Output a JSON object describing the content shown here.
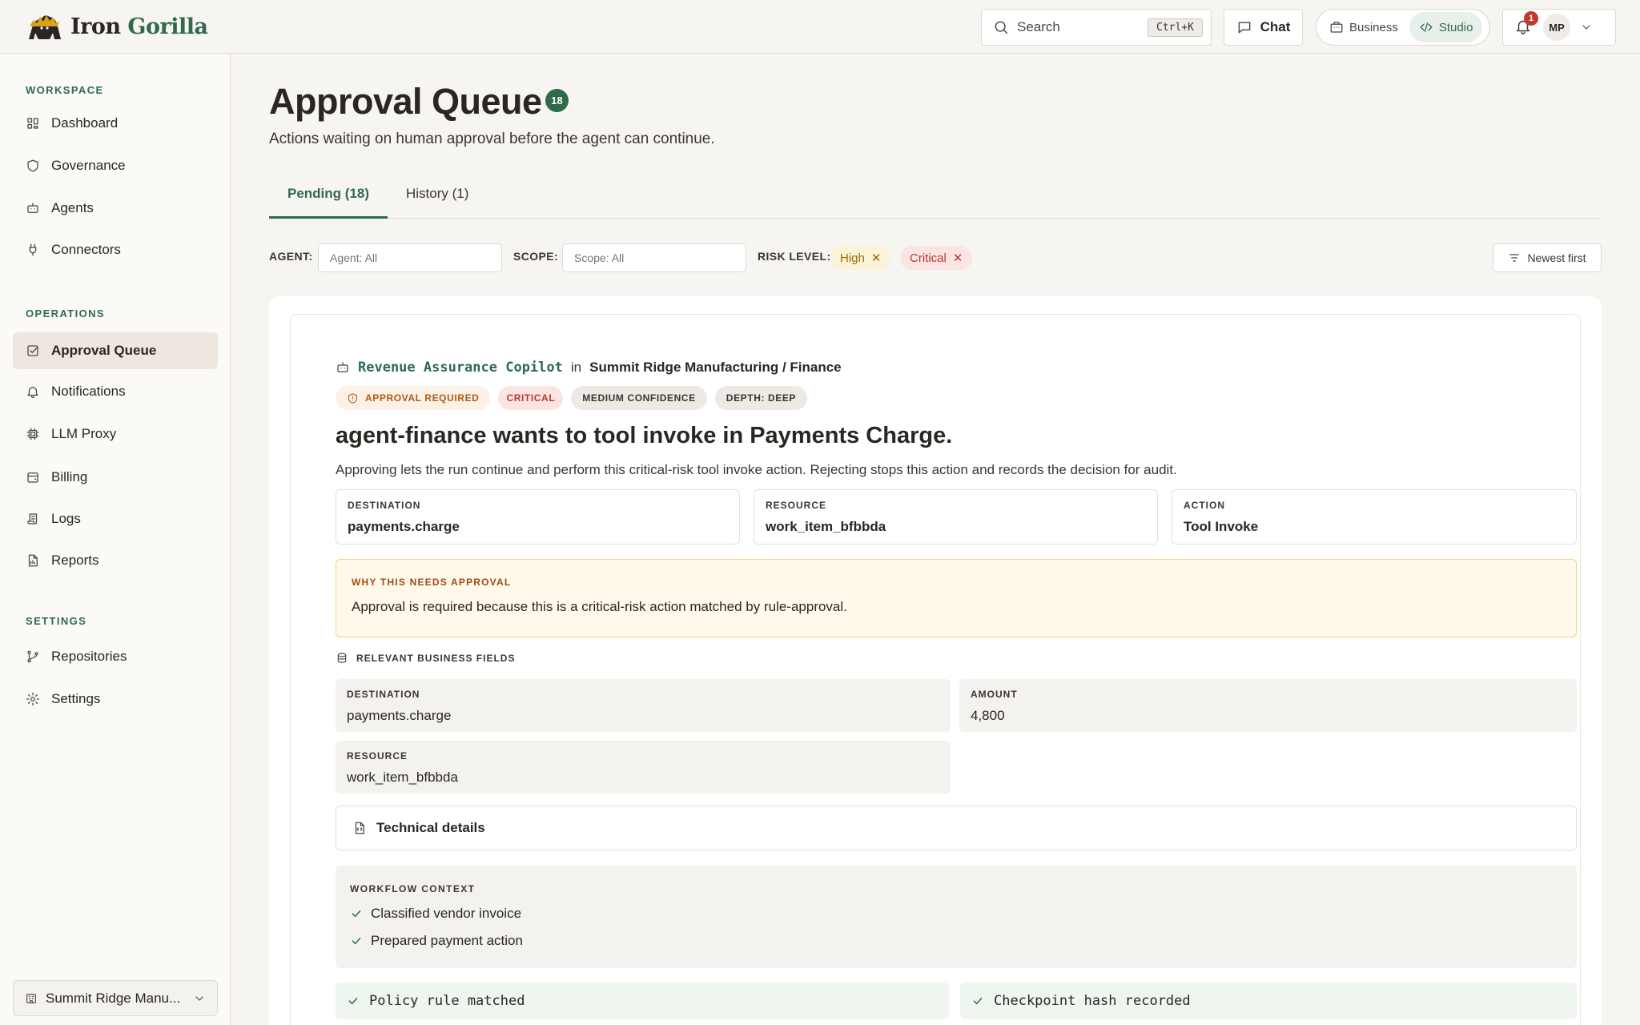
{
  "brand": {
    "name_part1": "Iron",
    "name_part2": "Gorilla"
  },
  "topbar": {
    "search_placeholder": "Search",
    "search_shortcut": "Ctrl+K",
    "chat_label": "Chat",
    "modes": [
      {
        "label": "Business"
      },
      {
        "label": "Studio",
        "active": true
      }
    ],
    "notification_count": "1",
    "user_initials": "MP"
  },
  "sidebar": {
    "sections": [
      {
        "title": "WORKSPACE",
        "items": [
          {
            "label": "Dashboard",
            "icon": "dashboard-icon"
          },
          {
            "label": "Governance",
            "icon": "shield-icon"
          },
          {
            "label": "Agents",
            "icon": "robot-icon"
          },
          {
            "label": "Connectors",
            "icon": "plug-icon"
          }
        ]
      },
      {
        "title": "OPERATIONS",
        "items": [
          {
            "label": "Approval Queue",
            "icon": "checkbox-icon",
            "active": true
          },
          {
            "label": "Notifications",
            "icon": "bell-icon"
          },
          {
            "label": "LLM Proxy",
            "icon": "chip-icon"
          },
          {
            "label": "Billing",
            "icon": "wallet-icon"
          },
          {
            "label": "Logs",
            "icon": "scroll-icon"
          },
          {
            "label": "Reports",
            "icon": "report-icon"
          }
        ]
      },
      {
        "title": "SETTINGS",
        "items": [
          {
            "label": "Repositories",
            "icon": "branch-icon"
          },
          {
            "label": "Settings",
            "icon": "gear-icon"
          }
        ]
      }
    ],
    "org_switcher": "Summit Ridge Manu..."
  },
  "page": {
    "title": "Approval Queue",
    "count": "18",
    "subtitle": "Actions waiting on human approval before the agent can continue.",
    "tabs": [
      {
        "label": "Pending (18)",
        "active": true
      },
      {
        "label": "History (1)"
      }
    ]
  },
  "filters": {
    "agent_label": "AGENT:",
    "agent_placeholder": "Agent: All",
    "scope_label": "SCOPE:",
    "scope_placeholder": "Scope: All",
    "risk_label": "RISK LEVEL:",
    "risk_chips": [
      "High",
      "Critical"
    ],
    "sort_label": "Newest first"
  },
  "request": {
    "agent_name": "Revenue Assurance Copilot",
    "in_word": "in",
    "org_path": "Summit Ridge Manufacturing / Finance",
    "badges": [
      "APPROVAL REQUIRED",
      "CRITICAL",
      "MEDIUM CONFIDENCE",
      "DEPTH: DEEP"
    ],
    "headline": "agent-finance wants to tool invoke in Payments Charge.",
    "description": "Approving lets the run continue and perform this critical-risk tool invoke action. Rejecting stops this action and records the decision for audit.",
    "summary": [
      {
        "key": "DESTINATION",
        "value": "payments.charge"
      },
      {
        "key": "RESOURCE",
        "value": "work_item_bfbbda"
      },
      {
        "key": "ACTION",
        "value": "Tool Invoke"
      }
    ],
    "why": {
      "title": "WHY THIS NEEDS APPROVAL",
      "text": "Approval is required because this is a critical-risk action matched by rule-approval."
    },
    "business_fields_title": "RELEVANT BUSINESS FIELDS",
    "business_fields": [
      {
        "key": "DESTINATION",
        "value": "payments.charge"
      },
      {
        "key": "AMOUNT",
        "value": "4,800"
      },
      {
        "key": "RESOURCE",
        "value": "work_item_bfbbda"
      }
    ],
    "technical_details": "Technical details",
    "workflow": {
      "title": "WORKFLOW CONTEXT",
      "items": [
        "Classified vendor invoice",
        "Prepared payment action"
      ]
    },
    "statuses": [
      "Policy rule matched",
      "Checkpoint hash recorded"
    ]
  },
  "colors": {
    "accent": "#2f6b4a",
    "critical": "#b33a2e",
    "warning": "#f0d67a"
  }
}
